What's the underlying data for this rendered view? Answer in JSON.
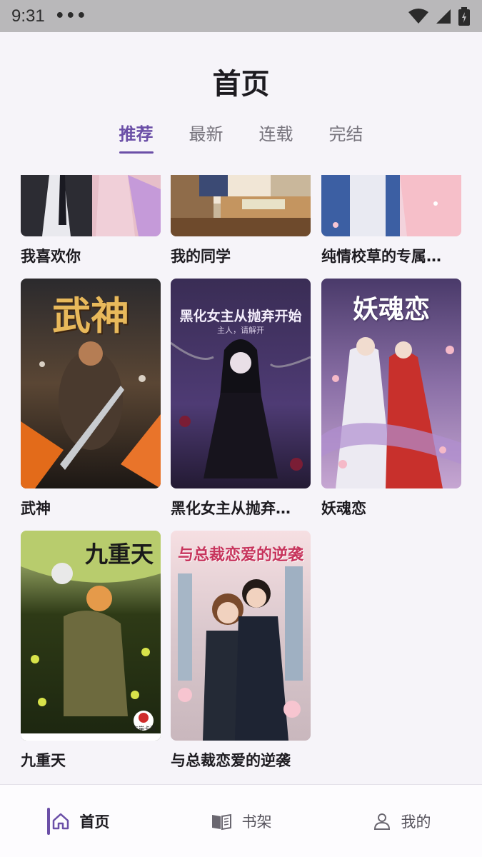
{
  "status_bar": {
    "time": "9:31",
    "more": "•••"
  },
  "header": {
    "title": "首页"
  },
  "tabs": [
    {
      "label": "推荐",
      "active": true
    },
    {
      "label": "最新",
      "active": false
    },
    {
      "label": "连载",
      "active": false
    },
    {
      "label": "完结",
      "active": false
    }
  ],
  "books": [
    {
      "title": "我喜欢你",
      "cover_text": ""
    },
    {
      "title": "我的同学",
      "cover_text": ""
    },
    {
      "title": "纯情校草的专属…",
      "cover_text": ""
    },
    {
      "title": "武神",
      "cover_text": "武神"
    },
    {
      "title": "黑化女主从抛弃…",
      "cover_text": "黑化女主从抛弃开始",
      "cover_subtext": "主人，请解开"
    },
    {
      "title": "妖魂恋",
      "cover_text": "妖魂恋"
    },
    {
      "title": "九重天",
      "cover_text": "九重天",
      "cover_badge": "左岸卡漫"
    },
    {
      "title": "与总裁恋爱的逆袭",
      "cover_text": "与总裁恋爱的逆袭"
    }
  ],
  "bottom_nav": [
    {
      "label": "首页",
      "icon": "home-icon",
      "active": true
    },
    {
      "label": "书架",
      "icon": "book-icon",
      "active": false
    },
    {
      "label": "我的",
      "icon": "person-icon",
      "active": false
    }
  ],
  "colors": {
    "accent": "#6b4fa7",
    "background": "#f6f4f9"
  }
}
